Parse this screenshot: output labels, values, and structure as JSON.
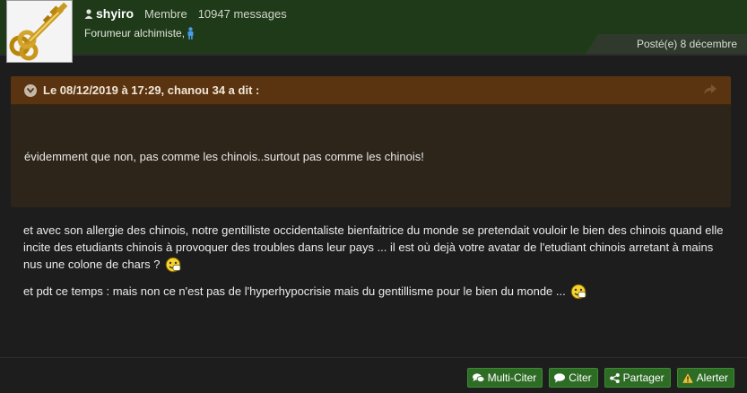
{
  "author": {
    "username": "shyiro",
    "role": "Membre",
    "message_count": "10947 messages",
    "rank": "Forumeur alchimiste,"
  },
  "post": {
    "posted_date": "Posté(e) 8 décembre"
  },
  "quote": {
    "header": "Le 08/12/2019 à 17:29, chanou 34 a dit :",
    "text": "évidemment que non, pas comme les chinois..surtout pas comme les chinois!"
  },
  "body": {
    "paragraph_1": "et avec son allergie des chinois, notre gentilliste occidentaliste bienfaitrice du monde se pretendait vouloir le bien des chinois quand elle incite des etudiants chinois à provoquer des troubles dans leur pays ... il est où dejà votre avatar de l'etudiant chinois arretant à mains nus une colone de chars ?",
    "paragraph_2": "et pdt ce temps : mais non ce n'est pas de l'hyperhypocrisie mais du gentillisme pour le bien du monde ..."
  },
  "actions": {
    "multi_quote": "Multi-Citer",
    "quote": "Citer",
    "share": "Partager",
    "report": "Alerter"
  },
  "colors": {
    "header_bg": "#1f3a19",
    "quote_header_bg": "#5a3411",
    "button_bg": "#2e6c26",
    "page_bg": "#1d1d1d"
  },
  "icons": {
    "user": "user-icon",
    "rank": "person-icon",
    "quote_toggle": "chevron-down-circle-icon",
    "quote_share": "share-arrow-icon",
    "multi_quote": "comments-icon",
    "quote": "comment-icon",
    "share": "share-icon",
    "report": "warning-icon"
  }
}
